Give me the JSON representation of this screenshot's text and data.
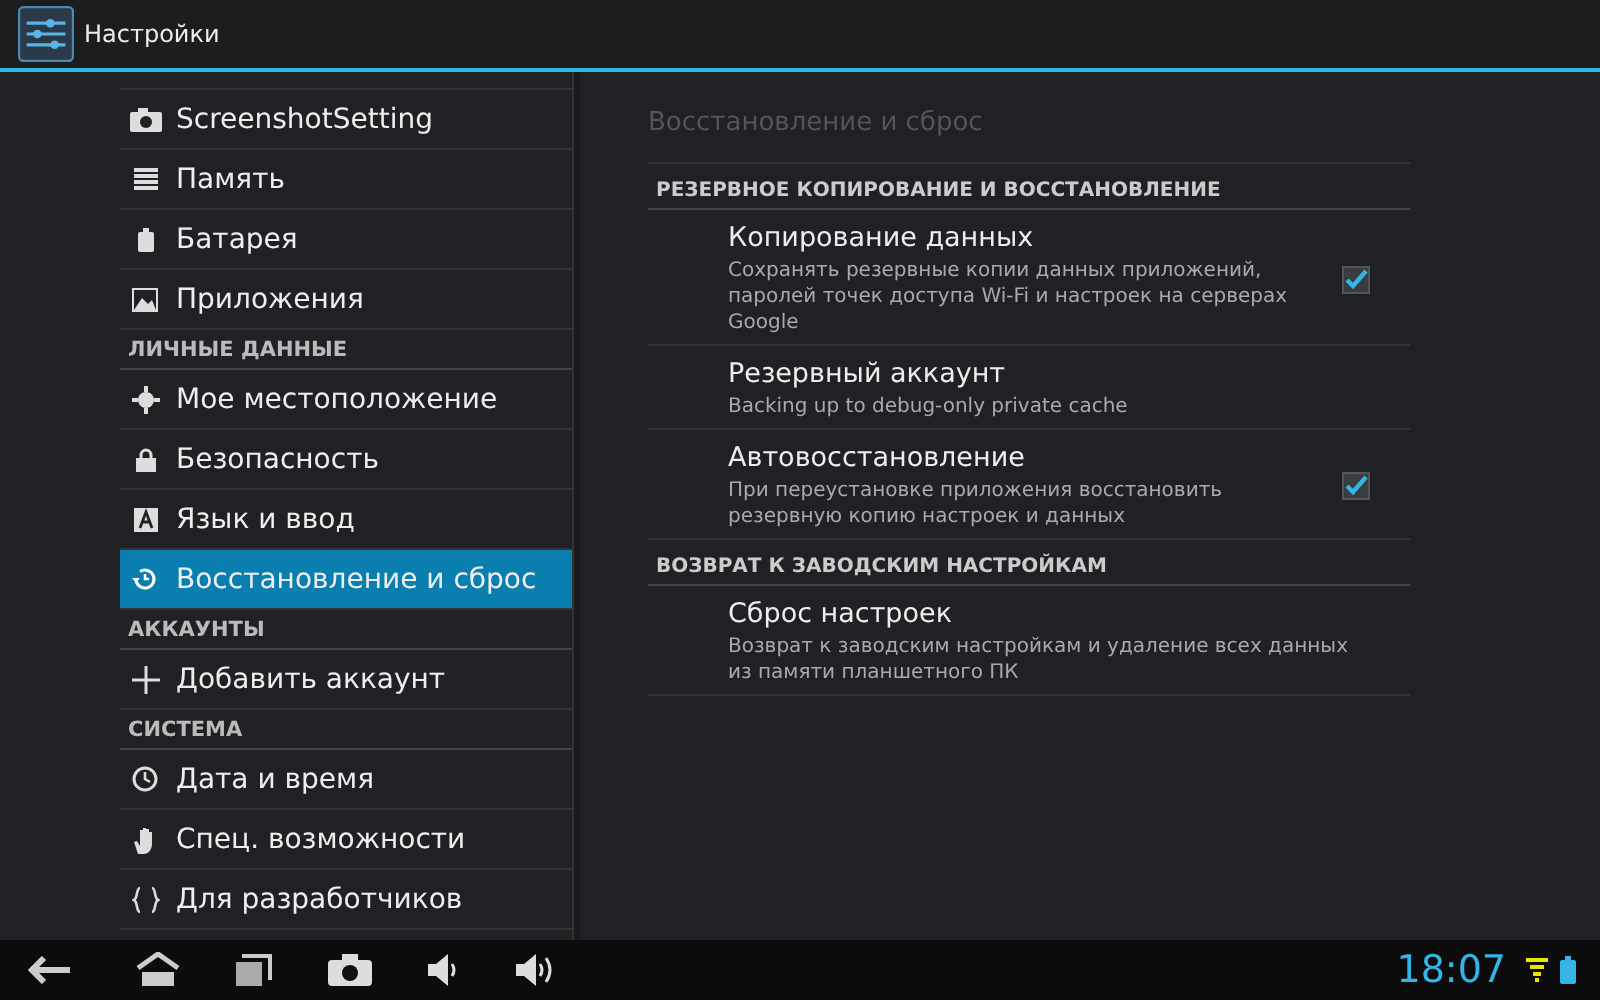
{
  "action_bar": {
    "title": "Настройки"
  },
  "sidebar": {
    "items": [
      {
        "kind": "item",
        "label": "ScreenshotSetting",
        "selected": false
      },
      {
        "kind": "item",
        "label": "Память",
        "selected": false
      },
      {
        "kind": "item",
        "label": "Батарея",
        "selected": false
      },
      {
        "kind": "item",
        "label": "Приложения",
        "selected": false
      },
      {
        "kind": "header",
        "label": "ЛИЧНЫЕ ДАННЫЕ"
      },
      {
        "kind": "item",
        "label": "Мое местоположение",
        "selected": false
      },
      {
        "kind": "item",
        "label": "Безопасность",
        "selected": false
      },
      {
        "kind": "item",
        "label": "Язык и ввод",
        "selected": false
      },
      {
        "kind": "item",
        "label": "Восстановление и сброс",
        "selected": true
      },
      {
        "kind": "header",
        "label": "АККАУНТЫ"
      },
      {
        "kind": "item",
        "label": "Добавить аккаунт",
        "selected": false
      },
      {
        "kind": "header",
        "label": "СИСТЕМА"
      },
      {
        "kind": "item",
        "label": "Дата и время",
        "selected": false
      },
      {
        "kind": "item",
        "label": "Спец. возможности",
        "selected": false
      },
      {
        "kind": "item",
        "label": "Для разработчиков",
        "selected": false
      }
    ]
  },
  "panel": {
    "title": "Восстановление и сброс",
    "sections": [
      {
        "header": "РЕЗЕРВНОЕ КОПИРОВАНИЕ И ВОССТАНОВЛЕНИЕ",
        "items": [
          {
            "kind": "check",
            "title": "Копирование данных",
            "summary": "Сохранять резервные копии данных приложений, паролей точек доступа Wi-Fi и настроек на серверах Google",
            "checked": true
          },
          {
            "kind": "plain",
            "title": "Резервный аккаунт",
            "summary": "Backing up to debug-only private cache"
          },
          {
            "kind": "check",
            "title": "Автовосстановление",
            "summary": "При переустановке приложения восстановить резервную копию настроек и данных",
            "checked": true
          }
        ]
      },
      {
        "header": "ВОЗВРАТ К ЗАВОДСКИМ НАСТРОЙКАМ",
        "items": [
          {
            "kind": "plain",
            "title": "Сброс настроек",
            "summary": "Возврат к заводским настройкам и удаление всех данных из памяти планшетного ПК"
          }
        ]
      }
    ]
  },
  "system_bar": {
    "time": "18:07"
  }
}
